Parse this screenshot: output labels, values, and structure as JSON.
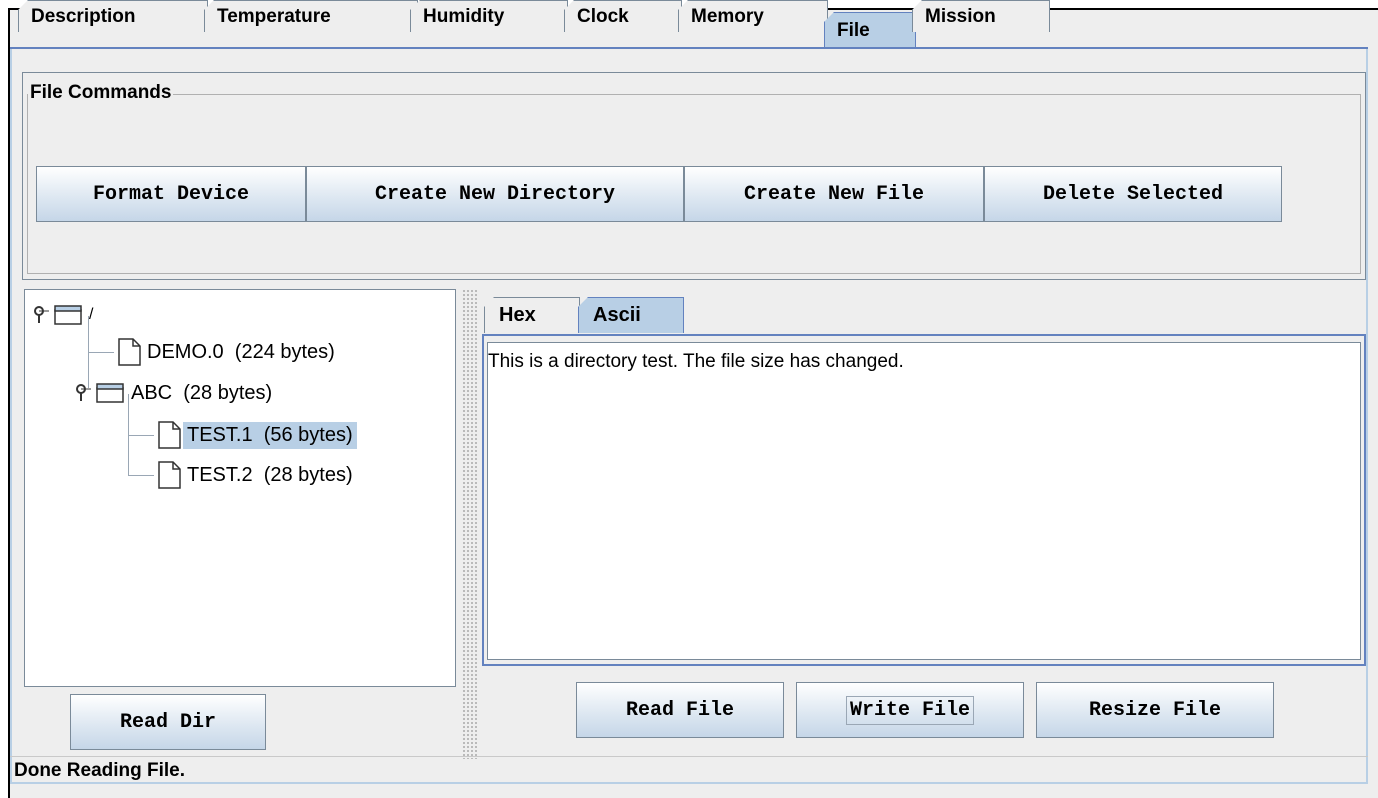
{
  "tabs": [
    "Description",
    "Temperature",
    "Humidity",
    "Clock",
    "Memory",
    "File",
    "Mission"
  ],
  "active_tab": "File",
  "file_commands": {
    "title": "File Commands",
    "buttons": [
      "Format Device",
      "Create New Directory",
      "Create New File",
      "Delete Selected"
    ]
  },
  "tree": {
    "root": "/",
    "items": [
      {
        "label": "DEMO.0  (224 bytes)"
      },
      {
        "label": "ABC  (28 bytes)"
      },
      {
        "label": "TEST.1  (56 bytes)",
        "selected": true
      },
      {
        "label": "TEST.2  (28 bytes)"
      }
    ],
    "read_dir_label": "Read Dir"
  },
  "viewer": {
    "subtabs": [
      "Hex",
      "Ascii"
    ],
    "active_subtab": "Ascii",
    "content": "This is a directory test. The file size has changed.",
    "buttons": [
      "Read File",
      "Write File",
      "Resize File"
    ]
  },
  "status": "Done Reading File.",
  "colors": {
    "selection": "#b8cfe5",
    "accent": "#6382bf",
    "background": "#eeeeee"
  }
}
